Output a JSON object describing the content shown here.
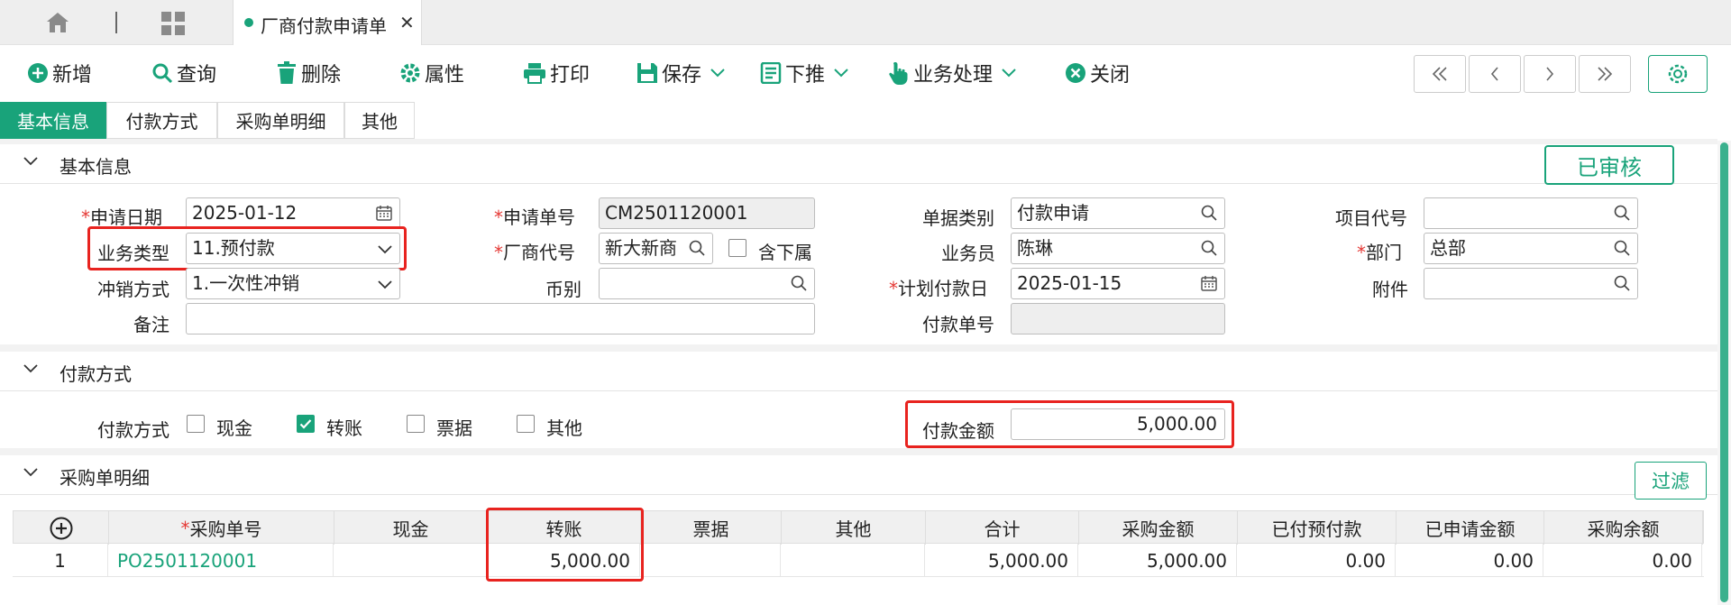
{
  "tab": {
    "title": "厂商付款申请单",
    "close": "✕"
  },
  "toolbar": {
    "add": "新增",
    "query": "查询",
    "delete": "删除",
    "props": "属性",
    "print": "打印",
    "save": "保存",
    "push": "下推",
    "biz": "业务处理",
    "close": "关闭"
  },
  "sections_tabs": [
    "基本信息",
    "付款方式",
    "采购单明细",
    "其他"
  ],
  "basic": {
    "title": "基本信息",
    "status": "已审核",
    "apply_date_label": "申请日期",
    "apply_date": "2025-01-12",
    "apply_no_label": "申请单号",
    "apply_no": "CM2501120001",
    "doc_type_label": "单据类别",
    "doc_type": "付款申请",
    "project_label": "项目代号",
    "project": "",
    "biz_type_label": "业务类型",
    "biz_type": "11.预付款",
    "vendor_label": "厂商代号",
    "vendor": "新大新商",
    "include_sub_label": "含下属",
    "salesman_label": "业务员",
    "salesman": "陈琳",
    "dept_label": "部门",
    "dept": "总部",
    "offset_label": "冲销方式",
    "offset": "1.一次性冲销",
    "currency_label": "币别",
    "currency": "",
    "plan_date_label": "计划付款日",
    "plan_date": "2025-01-15",
    "attach_label": "附件",
    "attach": "",
    "remark_label": "备注",
    "remark": "",
    "pay_no_label": "付款单号",
    "pay_no": ""
  },
  "payment": {
    "title": "付款方式",
    "method_label": "付款方式",
    "cash": "现金",
    "transfer": "转账",
    "bill": "票据",
    "other": "其他",
    "amount_label": "付款金额",
    "amount": "5,000.00"
  },
  "detail": {
    "title": "采购单明细",
    "filter": "过滤",
    "columns": [
      "采购单号",
      "现金",
      "转账",
      "票据",
      "其他",
      "合计",
      "采购金额",
      "已付预付款",
      "已申请金额",
      "采购余额"
    ],
    "rows": [
      {
        "idx": "1",
        "po": "PO2501120001",
        "cash": "",
        "transfer": "5,000.00",
        "bill": "",
        "other": "",
        "total": "5,000.00",
        "po_amount": "5,000.00",
        "prepaid": "0.00",
        "applied": "0.00",
        "balance": "0.00"
      }
    ]
  },
  "colors": {
    "accent": "#19a37a",
    "highlight": "#e8231f"
  }
}
